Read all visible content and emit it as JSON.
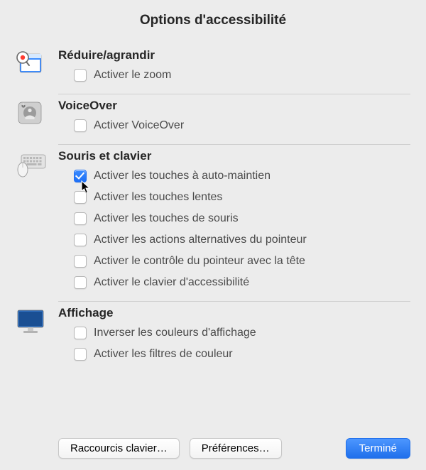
{
  "title": "Options d'accessibilité",
  "sections": {
    "zoom": {
      "heading": "Réduire/agrandir",
      "options": [
        {
          "label": "Activer le zoom",
          "checked": false
        }
      ]
    },
    "voiceover": {
      "heading": "VoiceOver",
      "options": [
        {
          "label": "Activer VoiceOver",
          "checked": false
        }
      ]
    },
    "mouse_keyboard": {
      "heading": "Souris et clavier",
      "options": [
        {
          "label": "Activer les touches à auto-maintien",
          "checked": true
        },
        {
          "label": "Activer les touches lentes",
          "checked": false
        },
        {
          "label": "Activer les touches de souris",
          "checked": false
        },
        {
          "label": "Activer les actions alternatives du pointeur",
          "checked": false
        },
        {
          "label": "Activer le contrôle du pointeur avec la tête",
          "checked": false
        },
        {
          "label": "Activer le clavier d'accessibilité",
          "checked": false
        }
      ]
    },
    "display": {
      "heading": "Affichage",
      "options": [
        {
          "label": "Inverser les couleurs d'affichage",
          "checked": false
        },
        {
          "label": "Activer les filtres de couleur",
          "checked": false
        }
      ]
    }
  },
  "footer": {
    "shortcuts": "Raccourcis clavier…",
    "preferences": "Préférences…",
    "done": "Terminé"
  }
}
